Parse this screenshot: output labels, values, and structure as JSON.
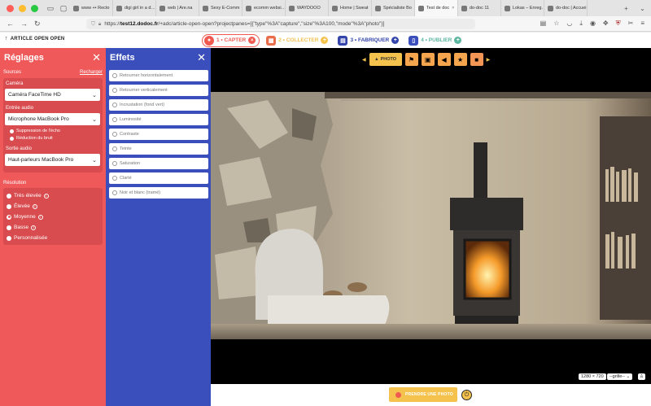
{
  "browser": {
    "tabs": [
      {
        "label": "www +• Recto"
      },
      {
        "label": "digi girl in a d…"
      },
      {
        "label": "web | Are.na"
      },
      {
        "label": "Sexy E-Comm"
      },
      {
        "label": "ecomm websi…"
      },
      {
        "label": "WAYDOOO"
      },
      {
        "label": "Home | Sweat"
      },
      {
        "label": "Spécialiste Bo"
      },
      {
        "label": "Test de doc",
        "active": true
      },
      {
        "label": "do-doc 11"
      },
      {
        "label": "Lokas – Enreg…"
      },
      {
        "label": "do-doc | Accuei"
      }
    ],
    "url_domain": "test12.dodoc.fr",
    "url_rest": "/+adc/article-open-open?projectpanes=[{\"type\"%3A\"capture\",\"size\"%3A100,\"mode\"%3A\"photo\"}]"
  },
  "app": {
    "article_title": "ARTICLE OPEN OPEN",
    "steps": {
      "capter": "1 • CAPTER",
      "collecter": "2 • COLLECTER",
      "fabriquer": "3 • FABRIQUER",
      "publier": "4 • PUBLIER"
    }
  },
  "reglages": {
    "title": "Réglages",
    "sources_label": "Sources",
    "reload_link": "Recharger",
    "camera_label": "Caméra",
    "camera_value": "Caméra FaceTime HD",
    "audio_in_label": "Entrée audio",
    "audio_in_value": "Microphone MacBook Pro",
    "echo_label": "Suppression de l'écho",
    "noise_label": "Réduction du bruit",
    "audio_out_label": "Sortie audio",
    "audio_out_value": "Haut-parleurs MacBook Pro",
    "resolution_label": "Résolution",
    "resolutions": [
      {
        "label": "Très élevée",
        "info": true
      },
      {
        "label": "Élevée",
        "info": true
      },
      {
        "label": "Moyenne",
        "info": true,
        "selected": true
      },
      {
        "label": "Basse",
        "info": true
      },
      {
        "label": "Personnalisée",
        "info": false
      }
    ]
  },
  "effets": {
    "title": "Effets",
    "items": [
      "Retourner horizontalement",
      "Retourner verticalement",
      "Incrustation (fond vert)",
      "Luminosité",
      "Contraste",
      "Teinte",
      "Saturation",
      "Clarté",
      "Noir et blanc (tramé)"
    ]
  },
  "capture": {
    "mode_photo_label": "PHOTO",
    "resolution_readout": "1280 × 720",
    "grid_select": "--grille--",
    "shoot_button": "PRENDRE UNE PHOTO"
  },
  "colors": {
    "reglages_bg": "#f0595a",
    "effets_bg": "#3a4fbb",
    "accent_yellow": "#f4c24d"
  }
}
